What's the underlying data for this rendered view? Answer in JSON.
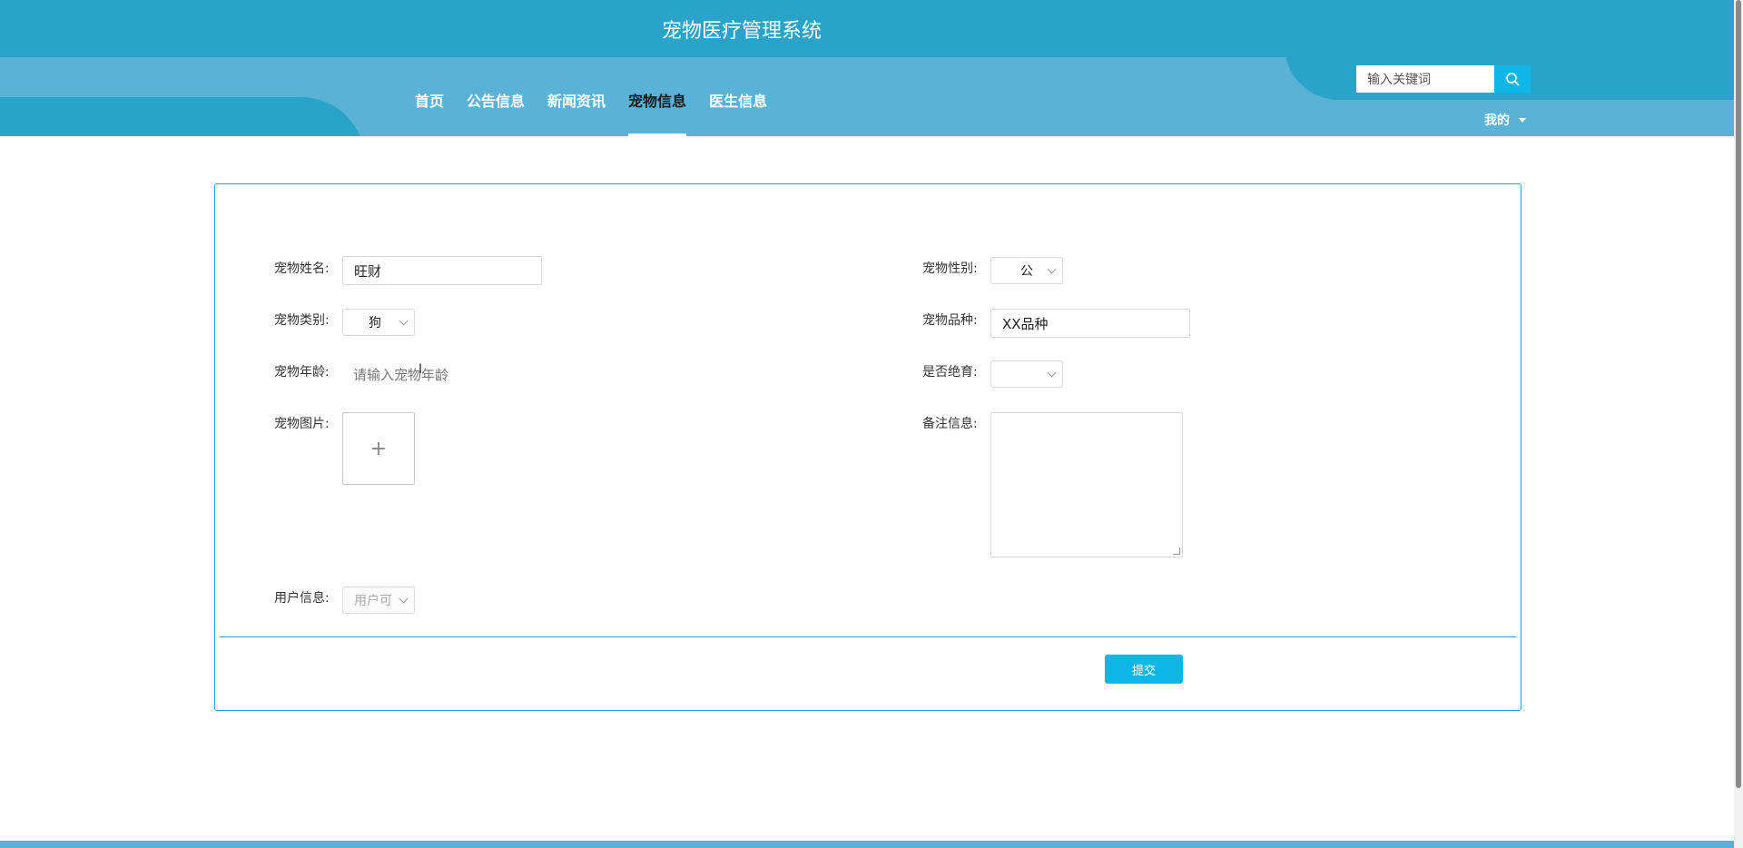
{
  "app": {
    "title": "宠物医疗管理系统"
  },
  "nav": {
    "items": [
      {
        "label": "首页"
      },
      {
        "label": "公告信息"
      },
      {
        "label": "新闻资讯"
      },
      {
        "label": "宠物信息",
        "active": true
      },
      {
        "label": "医生信息"
      }
    ]
  },
  "search": {
    "placeholder": "输入关键词",
    "icon": "search-icon"
  },
  "user_menu": {
    "label": "我的",
    "icon": "caret-down-icon"
  },
  "form": {
    "pet_name": {
      "label": "宠物姓名:",
      "value": "旺财"
    },
    "pet_gender": {
      "label": "宠物性别:",
      "value": "公"
    },
    "pet_category": {
      "label": "宠物类别:",
      "value": "狗"
    },
    "pet_breed": {
      "label": "宠物品种:",
      "value": "XX品种"
    },
    "pet_age": {
      "label": "宠物年龄:",
      "placeholder": "请输入宠物年龄"
    },
    "neutered": {
      "label": "是否绝育:",
      "value": ""
    },
    "pet_image": {
      "label": "宠物图片:",
      "upload_symbol": "+"
    },
    "remarks": {
      "label": "备注信息:",
      "value": ""
    },
    "user_info": {
      "label": "用户信息:",
      "value": "用户可"
    },
    "submit_label": "提交"
  },
  "colors": {
    "header_dark": "#2aa3c9",
    "header_light": "#5ab2d6",
    "accent": "#0fb7e8"
  }
}
